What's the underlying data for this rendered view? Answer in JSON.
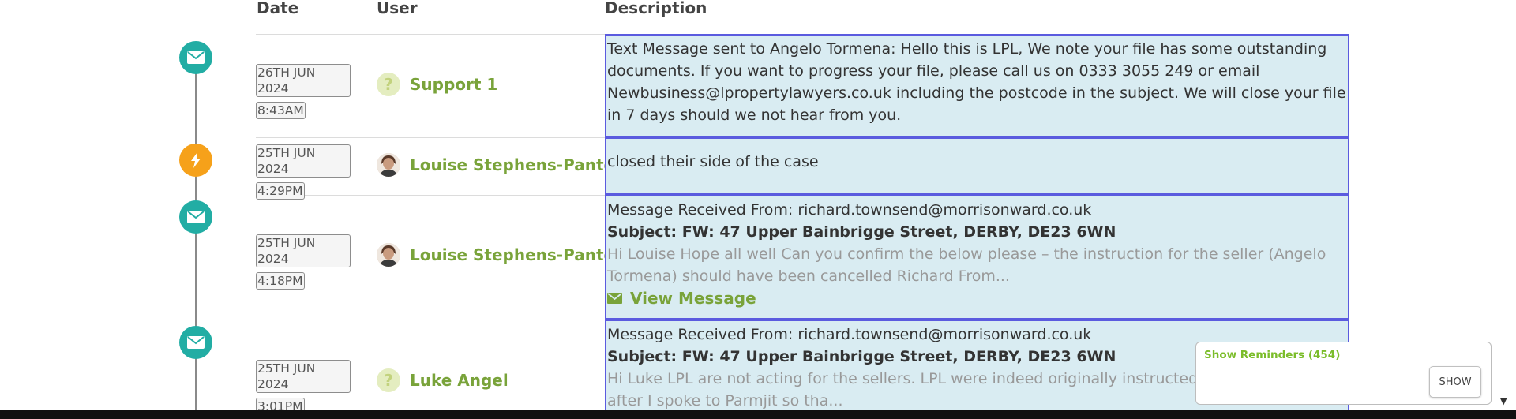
{
  "headers": {
    "date": "Date",
    "user": "User",
    "description": "Description"
  },
  "rows": [
    {
      "icon": "envelope-icon",
      "date_line1": "26TH JUN 2024",
      "date_line2": "8:43AM",
      "user": "Support 1",
      "avatar": "question",
      "description": "Text Message sent to Angelo Tormena: Hello this is LPL, We note your file has some outstanding documents. If you want to progress your file, please call us on 0333 3055 249 or email Newbusiness@lpropertylawyers.co.uk including the postcode in the subject. We will close your file in 7 days should we not hear from you."
    },
    {
      "icon": "bolt-icon",
      "date_line1": "25TH JUN 2024",
      "date_line2": "4:29PM",
      "user": "Louise Stephens-Pantoja",
      "avatar": "photo",
      "description": "closed their side of the case"
    },
    {
      "icon": "envelope-icon",
      "date_line1": "25TH JUN 2024",
      "date_line2": "4:18PM",
      "user": "Louise Stephens-Pantoja",
      "avatar": "photo",
      "received": "Message Received From: richard.townsend@morrisonward.co.uk",
      "subject": "Subject: FW: 47 Upper Bainbrigge Street, DERBY, DE23 6WN",
      "preview": "Hi Louise Hope all well Can you confirm the below please – the instruction for the seller (Angelo Tormena) should have been cancelled Richard From...",
      "view_label": "View Message"
    },
    {
      "icon": "envelope-icon",
      "date_line1": "25TH JUN 2024",
      "date_line2": "3:01PM",
      "user": "Luke Angel",
      "avatar": "question",
      "received": "Message Received From: richard.townsend@morrisonward.co.uk",
      "subject": "Subject: FW: 47 Upper Bainbrigge Street, DERBY, DE23 6WN",
      "preview_line1": "Hi Luke LPL are not acting for the sellers. LPL were indeed originally instructed but this w",
      "preview_line2": "after I spoke to Parmjit so tha..."
    }
  ],
  "reminders": {
    "title": "Show Reminders (454)",
    "button": "SHOW"
  },
  "colors": {
    "teal": "#22ada4",
    "orange": "#f6a11a",
    "green": "#79a33a",
    "desc_bg": "#d9ecf2",
    "desc_border": "#5b5bdf"
  }
}
